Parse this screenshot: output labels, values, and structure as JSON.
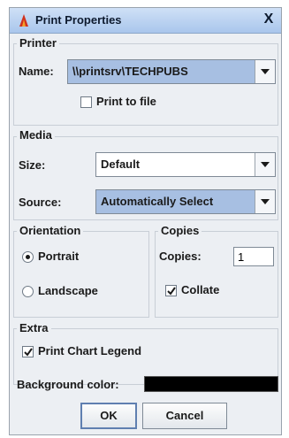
{
  "window": {
    "title": "Print Properties",
    "close_glyph": "X"
  },
  "printer": {
    "group_label": "Printer",
    "name_label": "Name:",
    "name_value": "\\\\printsrv\\TECHPUBS",
    "print_to_file_label": "Print to file",
    "print_to_file_checked": false
  },
  "media": {
    "group_label": "Media",
    "size_label": "Size:",
    "size_value": "Default",
    "source_label": "Source:",
    "source_value": "Automatically Select"
  },
  "orientation": {
    "group_label": "Orientation",
    "portrait_label": "Portrait",
    "landscape_label": "Landscape",
    "selected": "Portrait"
  },
  "copies": {
    "group_label": "Copies",
    "copies_label": "Copies:",
    "copies_value": "1",
    "collate_label": "Collate",
    "collate_checked": true
  },
  "extra": {
    "group_label": "Extra",
    "print_chart_legend_label": "Print Chart Legend",
    "print_chart_legend_checked": true,
    "background_color_label": "Background color:",
    "background_color": "#000000"
  },
  "buttons": {
    "ok_label": "OK",
    "cancel_label": "Cancel"
  },
  "icons": {
    "app": "printer-flame-icon",
    "close": "close-icon",
    "dropdown": "chevron-down-icon",
    "check": "checkmark-icon"
  },
  "colors": {
    "titlebar": "#a9c6ec",
    "dialog_bg": "#eceff3",
    "selected_field": "#a7bfe2"
  }
}
